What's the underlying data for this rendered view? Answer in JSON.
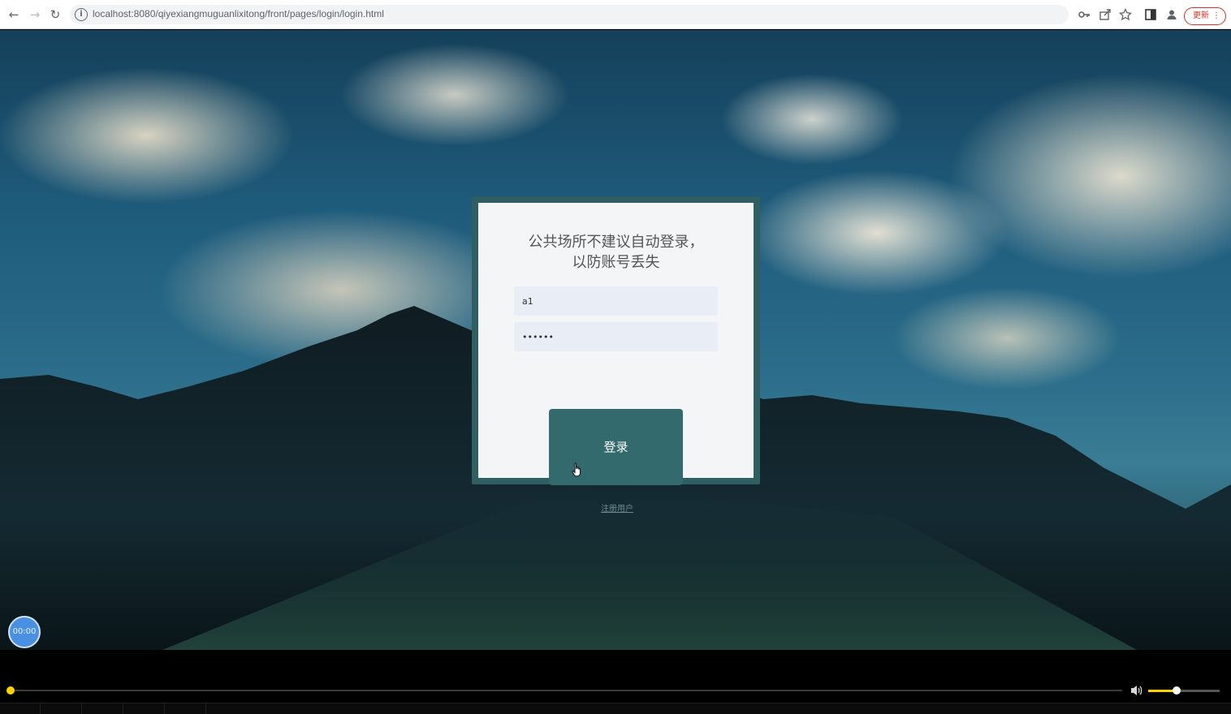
{
  "browser": {
    "back": "←",
    "forward": "→",
    "reload": "↻",
    "info": "i",
    "url": "localhost:8080/qiyexiangmuguanlixitong/front/pages/login/login.html",
    "update_label": "更新",
    "menu": "⋮"
  },
  "login": {
    "title_line1": "公共场所不建议自动登录，",
    "title_line2": "以防账号丢失",
    "username_value": "a1",
    "password_value": "••••••",
    "login_label": "登录",
    "register_label": "注册用户"
  },
  "player": {
    "timer": "00:00",
    "progress": 0.0,
    "volume": 0.4
  },
  "colors": {
    "card_frame": "#2f5f63",
    "button": "#336a6e",
    "accent_yellow": "#ffd200",
    "timer_blue": "#4a90e2"
  }
}
